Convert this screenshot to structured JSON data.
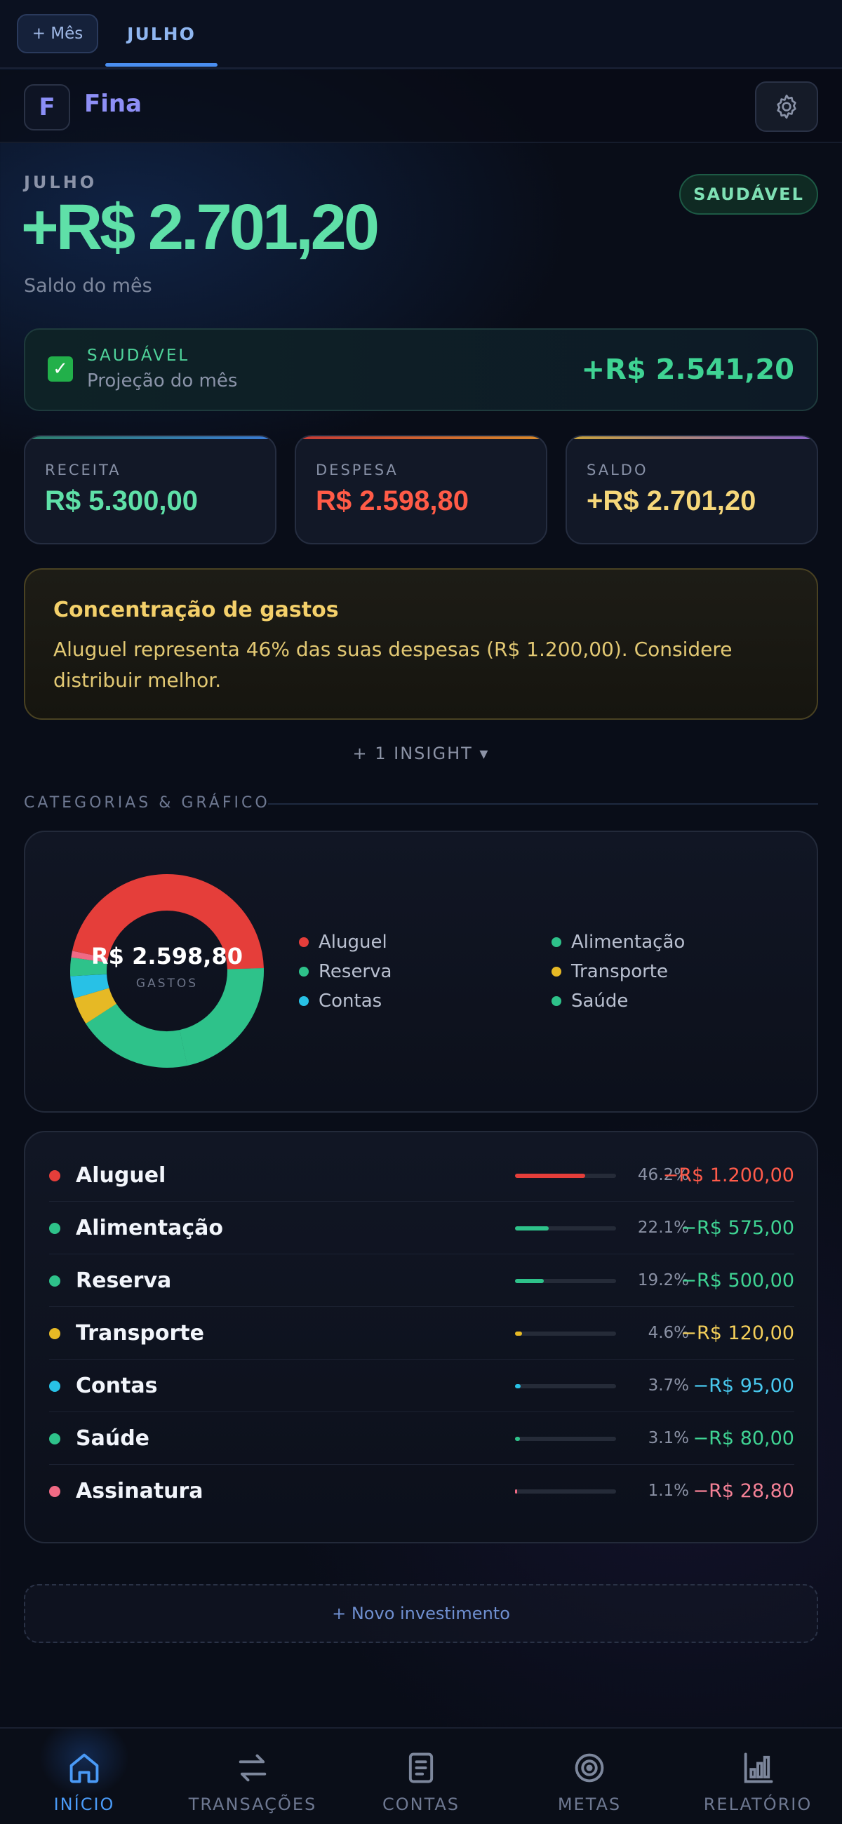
{
  "month_bar": {
    "add_month_label": "+ Mês",
    "active_month": "JULHO"
  },
  "app": {
    "logo_letter": "F",
    "brand": "Fina",
    "settings_icon": "gear-icon"
  },
  "hero": {
    "month": "JULHO",
    "balance": "+R$ 2.701,20",
    "subtitle": "Saldo do mês",
    "status": "SAUDÁVEL"
  },
  "projection": {
    "status": "SAUDÁVEL",
    "label": "Projeção do mês",
    "value": "+R$ 2.541,20",
    "icon": "check-icon"
  },
  "stats": [
    {
      "label": "RECEITA",
      "value": "R$ 5.300,00",
      "color": "#5fe0a8",
      "bar": "#3a7bd5"
    },
    {
      "label": "DESPESA",
      "value": "R$ 2.598,80",
      "color": "#ff5b47",
      "bar": "#e5533b"
    },
    {
      "label": "SALDO",
      "value": "+R$ 2.701,20",
      "color": "#f6d77a",
      "bar": "#c79a3a"
    }
  ],
  "insight": {
    "title": "Concentração de gastos",
    "text": "Aluguel representa 46% das suas despesas (R$ 1.200,00). Considere distribuir melhor.",
    "more": "+ 1 INSIGHT ▾"
  },
  "section": {
    "title": "CATEGORIAS & GRÁFICO"
  },
  "chart_data": {
    "type": "pie",
    "center_value": "R$ 2.598,80",
    "center_label": "GASTOS",
    "categories": [
      "Aluguel",
      "Alimentação",
      "Reserva",
      "Transporte",
      "Contas",
      "Saúde",
      "Assinatura"
    ],
    "values": [
      46.2,
      22.1,
      19.2,
      4.6,
      3.7,
      3.1,
      1.1
    ],
    "colors": [
      "#e53e3a",
      "#2ec28a",
      "#2ec28a",
      "#e6b925",
      "#28c1e6",
      "#2ec28a",
      "#f06a84"
    ],
    "legend": [
      "Aluguel",
      "Alimentação",
      "Reserva",
      "Transporte",
      "Contas",
      "Saúde"
    ]
  },
  "categories": [
    {
      "name": "Aluguel",
      "pct": "46.2%",
      "amount": "−R$ 1.200,00",
      "color": "#e53e3a",
      "amount_color": "#ff5b4a",
      "fill": 0.462
    },
    {
      "name": "Alimentação",
      "pct": "22.1%",
      "amount": "−R$ 575,00",
      "color": "#2ec28a",
      "amount_color": "#3fd393",
      "fill": 0.221
    },
    {
      "name": "Reserva",
      "pct": "19.2%",
      "amount": "−R$ 500,00",
      "color": "#2ec28a",
      "amount_color": "#3fd393",
      "fill": 0.192
    },
    {
      "name": "Transporte",
      "pct": "4.6%",
      "amount": "−R$ 120,00",
      "color": "#e6b925",
      "amount_color": "#f4cf5a",
      "fill": 0.046
    },
    {
      "name": "Contas",
      "pct": "3.7%",
      "amount": "−R$ 95,00",
      "color": "#28c1e6",
      "amount_color": "#48c8ee",
      "fill": 0.037
    },
    {
      "name": "Saúde",
      "pct": "3.1%",
      "amount": "−R$ 80,00",
      "color": "#2ec28a",
      "amount_color": "#3fd393",
      "fill": 0.031
    },
    {
      "name": "Assinatura",
      "pct": "1.1%",
      "amount": "−R$ 28,80",
      "color": "#f06a84",
      "amount_color": "#f58196",
      "fill": 0.011
    }
  ],
  "actions": {
    "new_investment": "+ Novo investimento"
  },
  "nav": [
    {
      "label": "INÍCIO",
      "icon": "home-icon",
      "active": true
    },
    {
      "label": "TRANSAÇÕES",
      "icon": "transfer-icon",
      "active": false
    },
    {
      "label": "CONTAS",
      "icon": "document-icon",
      "active": false
    },
    {
      "label": "METAS",
      "icon": "target-icon",
      "active": false
    },
    {
      "label": "RELATÓRIO",
      "icon": "bar-chart-icon",
      "active": false
    }
  ]
}
